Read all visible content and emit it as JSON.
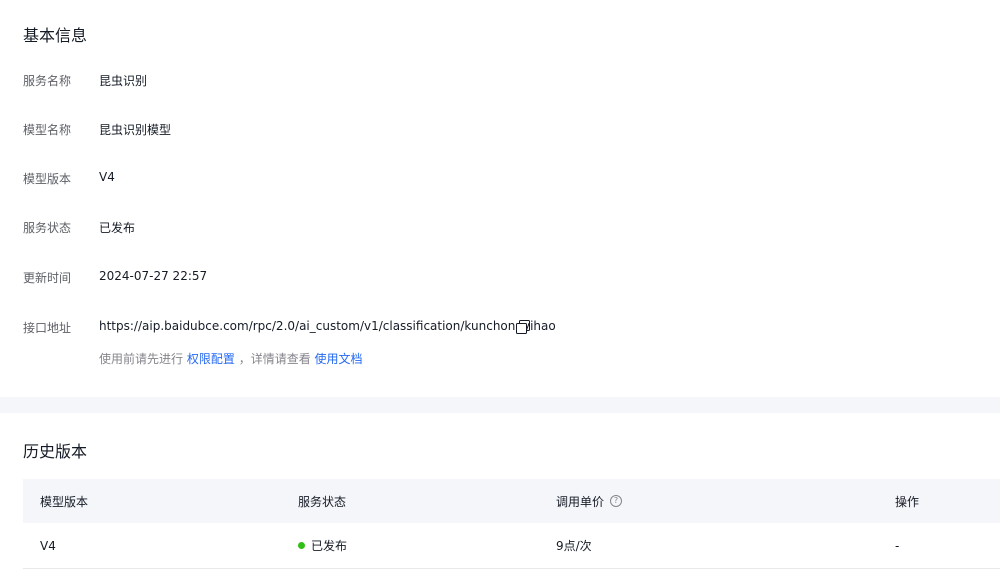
{
  "basic": {
    "title": "基本信息",
    "rows": [
      {
        "label": "服务名称",
        "value": "昆虫识别"
      },
      {
        "label": "模型名称",
        "value": "昆虫识别模型"
      },
      {
        "label": "模型版本",
        "value": "V4"
      },
      {
        "label": "服务状态",
        "value": "已发布"
      },
      {
        "label": "更新时间",
        "value": "2024-07-27 22:57"
      },
      {
        "label": "接口地址",
        "value": "https://aip.baidubce.com/rpc/2.0/ai_custom/v1/classification/kunchongyihao"
      }
    ],
    "copy_icon": "copy-icon",
    "hint": {
      "prefix": "使用前请先进行",
      "link1": "权限配置",
      "middle": "，详情请查看",
      "link2": "使用文档"
    }
  },
  "history": {
    "title": "历史版本",
    "columns": [
      "模型版本",
      "服务状态",
      "调用单价",
      "操作"
    ],
    "help_icon_glyph": "?",
    "rows": [
      {
        "version": "V4",
        "status": "已发布",
        "status_color": "#30bf13",
        "price": "9点/次",
        "action": "-"
      }
    ]
  },
  "colors": {
    "link": "#2468f2",
    "published": "#30bf13",
    "section_gap": "#f5f6f9"
  }
}
